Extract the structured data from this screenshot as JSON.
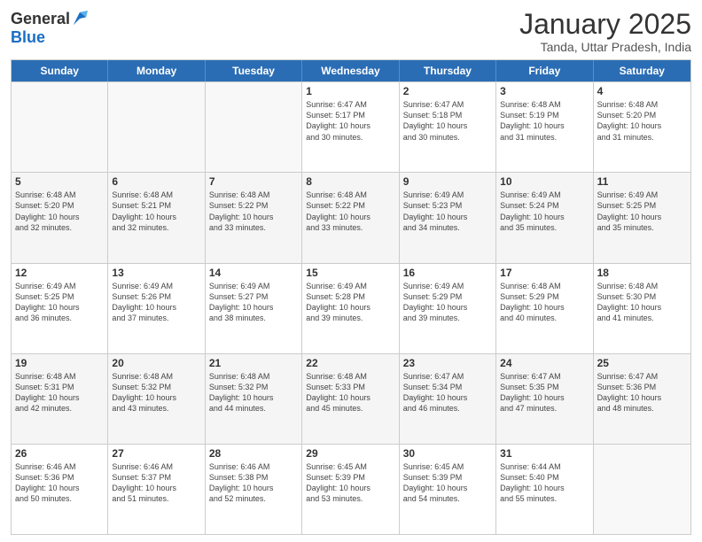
{
  "header": {
    "logo_line1": "General",
    "logo_line2": "Blue",
    "title": "January 2025",
    "subtitle": "Tanda, Uttar Pradesh, India"
  },
  "days_of_week": [
    "Sunday",
    "Monday",
    "Tuesday",
    "Wednesday",
    "Thursday",
    "Friday",
    "Saturday"
  ],
  "weeks": [
    [
      {
        "day": "",
        "info": ""
      },
      {
        "day": "",
        "info": ""
      },
      {
        "day": "",
        "info": ""
      },
      {
        "day": "1",
        "info": "Sunrise: 6:47 AM\nSunset: 5:17 PM\nDaylight: 10 hours\nand 30 minutes."
      },
      {
        "day": "2",
        "info": "Sunrise: 6:47 AM\nSunset: 5:18 PM\nDaylight: 10 hours\nand 30 minutes."
      },
      {
        "day": "3",
        "info": "Sunrise: 6:48 AM\nSunset: 5:19 PM\nDaylight: 10 hours\nand 31 minutes."
      },
      {
        "day": "4",
        "info": "Sunrise: 6:48 AM\nSunset: 5:20 PM\nDaylight: 10 hours\nand 31 minutes."
      }
    ],
    [
      {
        "day": "5",
        "info": "Sunrise: 6:48 AM\nSunset: 5:20 PM\nDaylight: 10 hours\nand 32 minutes."
      },
      {
        "day": "6",
        "info": "Sunrise: 6:48 AM\nSunset: 5:21 PM\nDaylight: 10 hours\nand 32 minutes."
      },
      {
        "day": "7",
        "info": "Sunrise: 6:48 AM\nSunset: 5:22 PM\nDaylight: 10 hours\nand 33 minutes."
      },
      {
        "day": "8",
        "info": "Sunrise: 6:48 AM\nSunset: 5:22 PM\nDaylight: 10 hours\nand 33 minutes."
      },
      {
        "day": "9",
        "info": "Sunrise: 6:49 AM\nSunset: 5:23 PM\nDaylight: 10 hours\nand 34 minutes."
      },
      {
        "day": "10",
        "info": "Sunrise: 6:49 AM\nSunset: 5:24 PM\nDaylight: 10 hours\nand 35 minutes."
      },
      {
        "day": "11",
        "info": "Sunrise: 6:49 AM\nSunset: 5:25 PM\nDaylight: 10 hours\nand 35 minutes."
      }
    ],
    [
      {
        "day": "12",
        "info": "Sunrise: 6:49 AM\nSunset: 5:25 PM\nDaylight: 10 hours\nand 36 minutes."
      },
      {
        "day": "13",
        "info": "Sunrise: 6:49 AM\nSunset: 5:26 PM\nDaylight: 10 hours\nand 37 minutes."
      },
      {
        "day": "14",
        "info": "Sunrise: 6:49 AM\nSunset: 5:27 PM\nDaylight: 10 hours\nand 38 minutes."
      },
      {
        "day": "15",
        "info": "Sunrise: 6:49 AM\nSunset: 5:28 PM\nDaylight: 10 hours\nand 39 minutes."
      },
      {
        "day": "16",
        "info": "Sunrise: 6:49 AM\nSunset: 5:29 PM\nDaylight: 10 hours\nand 39 minutes."
      },
      {
        "day": "17",
        "info": "Sunrise: 6:48 AM\nSunset: 5:29 PM\nDaylight: 10 hours\nand 40 minutes."
      },
      {
        "day": "18",
        "info": "Sunrise: 6:48 AM\nSunset: 5:30 PM\nDaylight: 10 hours\nand 41 minutes."
      }
    ],
    [
      {
        "day": "19",
        "info": "Sunrise: 6:48 AM\nSunset: 5:31 PM\nDaylight: 10 hours\nand 42 minutes."
      },
      {
        "day": "20",
        "info": "Sunrise: 6:48 AM\nSunset: 5:32 PM\nDaylight: 10 hours\nand 43 minutes."
      },
      {
        "day": "21",
        "info": "Sunrise: 6:48 AM\nSunset: 5:32 PM\nDaylight: 10 hours\nand 44 minutes."
      },
      {
        "day": "22",
        "info": "Sunrise: 6:48 AM\nSunset: 5:33 PM\nDaylight: 10 hours\nand 45 minutes."
      },
      {
        "day": "23",
        "info": "Sunrise: 6:47 AM\nSunset: 5:34 PM\nDaylight: 10 hours\nand 46 minutes."
      },
      {
        "day": "24",
        "info": "Sunrise: 6:47 AM\nSunset: 5:35 PM\nDaylight: 10 hours\nand 47 minutes."
      },
      {
        "day": "25",
        "info": "Sunrise: 6:47 AM\nSunset: 5:36 PM\nDaylight: 10 hours\nand 48 minutes."
      }
    ],
    [
      {
        "day": "26",
        "info": "Sunrise: 6:46 AM\nSunset: 5:36 PM\nDaylight: 10 hours\nand 50 minutes."
      },
      {
        "day": "27",
        "info": "Sunrise: 6:46 AM\nSunset: 5:37 PM\nDaylight: 10 hours\nand 51 minutes."
      },
      {
        "day": "28",
        "info": "Sunrise: 6:46 AM\nSunset: 5:38 PM\nDaylight: 10 hours\nand 52 minutes."
      },
      {
        "day": "29",
        "info": "Sunrise: 6:45 AM\nSunset: 5:39 PM\nDaylight: 10 hours\nand 53 minutes."
      },
      {
        "day": "30",
        "info": "Sunrise: 6:45 AM\nSunset: 5:39 PM\nDaylight: 10 hours\nand 54 minutes."
      },
      {
        "day": "31",
        "info": "Sunrise: 6:44 AM\nSunset: 5:40 PM\nDaylight: 10 hours\nand 55 minutes."
      },
      {
        "day": "",
        "info": ""
      }
    ]
  ]
}
